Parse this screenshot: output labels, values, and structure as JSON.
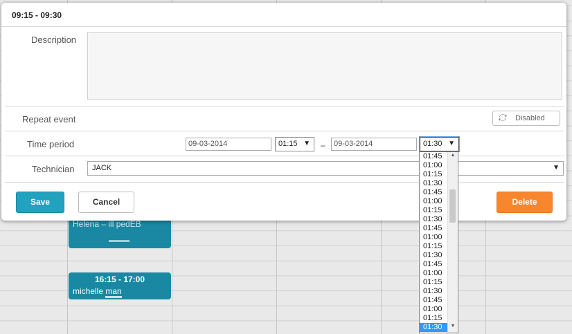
{
  "event_dialog": {
    "title": "09:15 - 09:30",
    "description_label": "Description",
    "description_value": "",
    "repeat_label": "Repeat event",
    "repeat_toggle_label": "Disabled",
    "time_period_label": "Time period",
    "start_date": "09-03-2014",
    "start_time": "01:15",
    "separator": "–",
    "end_date": "09-03-2014",
    "end_time": "01:30",
    "technician_label": "Technician",
    "technician_value": "JACK",
    "save_label": "Save",
    "cancel_label": "Cancel",
    "delete_label": "Delete"
  },
  "end_time_options": [
    "01:45",
    "01:00",
    "01:15",
    "01:30",
    "01:45",
    "01:00",
    "01:15",
    "01:30",
    "01:45",
    "01:00",
    "01:15",
    "01:30",
    "01:45",
    "01:00",
    "01:15",
    "01:30",
    "01:45",
    "01:00",
    "01:15",
    "01:30"
  ],
  "end_time_selected_index": 19,
  "calendar_events": [
    {
      "time": "",
      "text": "Helena – ill pedEB",
      "link": ""
    },
    {
      "time": "16:15 - 17:00",
      "name": "michelle",
      "link": "man"
    }
  ],
  "colors": {
    "event": "#1a88a3",
    "save": "#21a2bf",
    "delete": "#f7862c",
    "selected": "#3399ff"
  }
}
